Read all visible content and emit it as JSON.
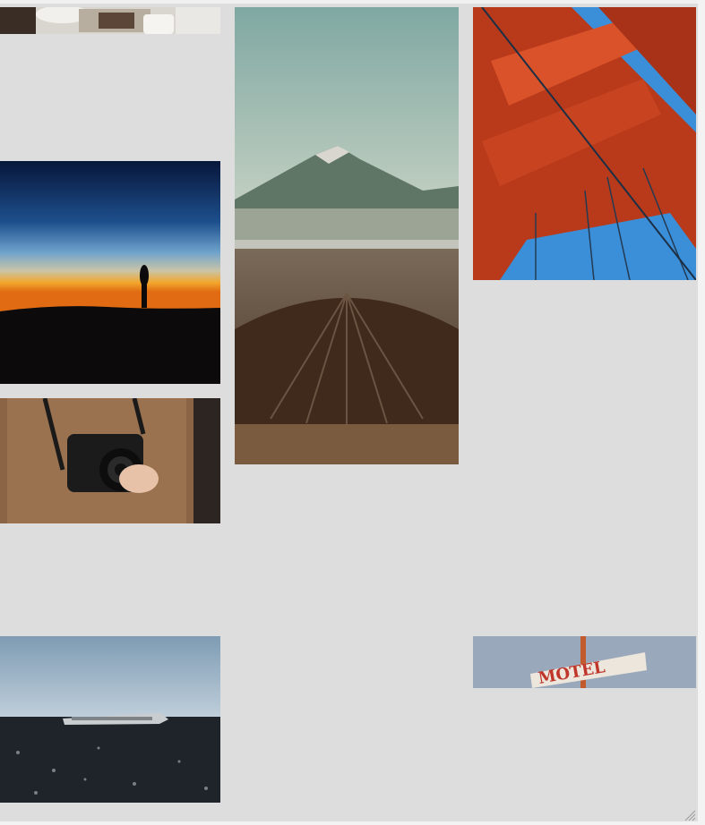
{
  "gallery": {
    "images": [
      {
        "id": "coffee",
        "subject": "coffee-table-photo"
      },
      {
        "id": "silhouette",
        "subject": "sunset-silhouette-photo"
      },
      {
        "id": "camera",
        "subject": "camera-hands-photo"
      },
      {
        "id": "plane",
        "subject": "plane-wreck-photo"
      },
      {
        "id": "volcano",
        "subject": "volcano-photo"
      },
      {
        "id": "bridge",
        "subject": "red-bridge-tower-photo"
      },
      {
        "id": "motel",
        "subject": "motel-sign-photo",
        "sign_text": "MOTEL"
      }
    ],
    "colors": {
      "background": "#dddddd",
      "sky_blue": "#3a8fd8",
      "bridge_red": "#c8421f",
      "sunset_orange": "#f08a1c"
    }
  }
}
